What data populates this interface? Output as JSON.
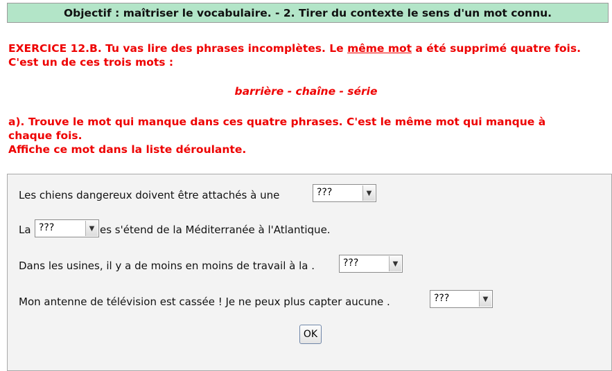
{
  "header": {
    "title": "Objectif : maîtriser le vocabulaire. - 2. Tirer du contexte le sens d'un mot connu."
  },
  "instructions": {
    "line1_part1": "EXERCICE 12.B. Tu vas lire des phrases incomplètes. Le ",
    "line1_underlined": "même mot",
    "line1_part2": " a été supprimé quatre fois.",
    "line2": "C'est un de ces trois mots :",
    "words": "barrière - chaîne - série",
    "task_line1": "a). Trouve le mot qui manque dans ces quatre phrases. C'est le même mot qui manque à",
    "task_line2": "chaque fois.",
    "task_line3": "Affiche ce mot dans la liste déroulante."
  },
  "exercise": {
    "s1": {
      "before": "Les chiens dangereux doivent être attachés à une",
      "select_value": "???"
    },
    "s2": {
      "before": "La",
      "after": "es s'étend de la Méditerranée à l'Atlantique.",
      "select_value": "???"
    },
    "s3": {
      "before": "Dans les usines, il y a de moins en moins de travail à la  .",
      "select_value": "???"
    },
    "s4": {
      "before": "Mon antenne de télévision est cassée ! Je ne peux plus capter aucune   .",
      "select_value": "???"
    },
    "ok_label": "OK"
  },
  "icons": {
    "dropdown_arrow": "chevron-down-icon"
  },
  "colors": {
    "header_bg": "#b3e5c8",
    "instruction_text": "#ee0000",
    "panel_bg": "#f3f3f3"
  }
}
